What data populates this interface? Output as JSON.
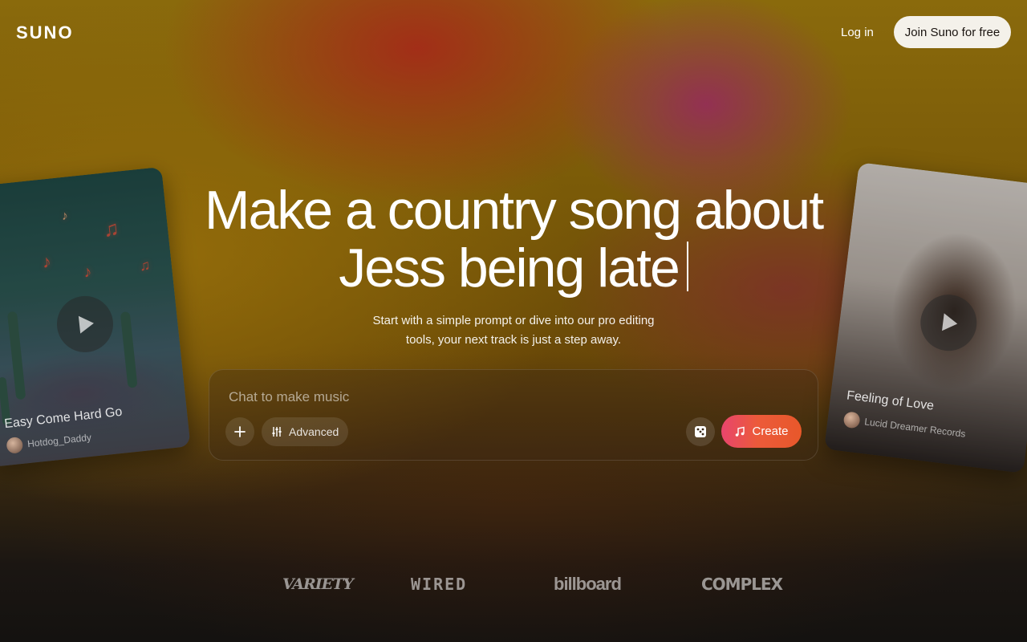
{
  "header": {
    "logo": "SUNO",
    "login_label": "Log in",
    "join_label": "Join Suno for free"
  },
  "hero": {
    "headline_line1": "Make a country song about",
    "headline_line2": "Jess being late",
    "subtext_line1": "Start with a simple prompt or dive into our pro editing",
    "subtext_line2": "tools, your next track is just a step away."
  },
  "prompt": {
    "placeholder": "Chat to make music",
    "value": "",
    "advanced_label": "Advanced",
    "create_label": "Create",
    "icons": {
      "add": "plus-icon",
      "advanced": "sliders-icon",
      "random": "dice-icon",
      "create": "music-note-icon"
    }
  },
  "cards": [
    {
      "title": "Easy Come Hard Go",
      "artist": "Hotdog_Daddy"
    },
    {
      "title": "Feeling of Love",
      "artist": "Lucid Dreamer Records"
    }
  ],
  "press": [
    "VARIETY",
    "WIRED",
    "billboard",
    "COMPLEX"
  ],
  "colors": {
    "join_button_bg": "#f4f1ea",
    "create_gradient_start": "#e8456d",
    "create_gradient_end": "#e8582a"
  }
}
